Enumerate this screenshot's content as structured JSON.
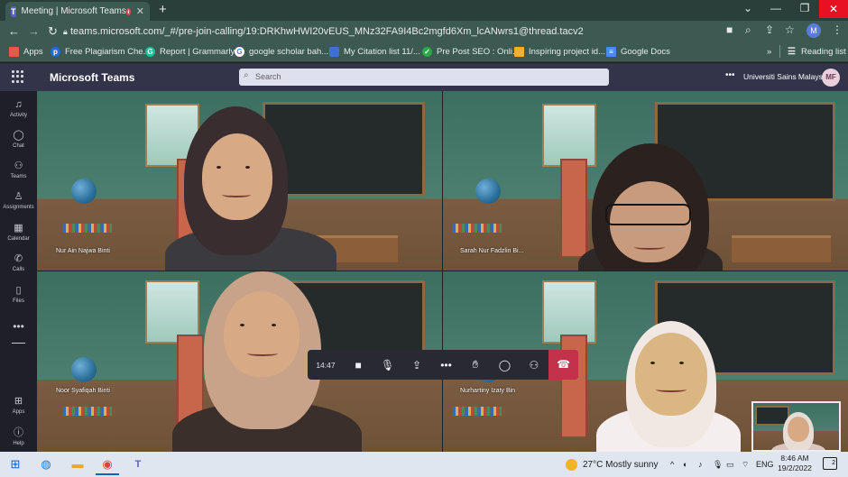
{
  "browser": {
    "tab_title": "Meeting | Microsoft Teams",
    "new_tab": "+",
    "url": "teams.microsoft.com/_#/pre-join-calling/19:DRKhwHWI20vEUS_MNz32FA9I4Bc2mgfd6Xm_lcANwrs1@thread.tacv2",
    "profile_initial": "M",
    "reading_list": "Reading list",
    "bookmarks": [
      {
        "label": "Apps",
        "icon": "apps-grid-icon",
        "color": "#e05a4e"
      },
      {
        "label": "Free Plagiarism Che...",
        "icon": "plagiarism-icon",
        "color": "#1d6fd3"
      },
      {
        "label": "Report | Grammarly",
        "icon": "grammarly-icon",
        "color": "#15c39a"
      },
      {
        "label": "google scholar bah...",
        "icon": "google-icon",
        "color": "#ffffff"
      },
      {
        "label": "My Citation list 11/...",
        "icon": "citation-icon",
        "color": "#3d6fd6"
      },
      {
        "label": "Pre Post SEO : Onli...",
        "icon": "prepostseo-icon",
        "color": "#2aa84a"
      },
      {
        "label": "Inspiring project id...",
        "icon": "project-icon",
        "color": "#f0b030"
      },
      {
        "label": "Google Docs",
        "icon": "google-docs-icon",
        "color": "#4a8af4"
      }
    ]
  },
  "teams": {
    "app_name": "Microsoft Teams",
    "search_placeholder": "Search",
    "organization": "Universiti Sains Malaysia",
    "avatar_initials": "MF",
    "rail": [
      {
        "label": "Activity",
        "icon": "bell-icon"
      },
      {
        "label": "Chat",
        "icon": "chat-icon"
      },
      {
        "label": "Teams",
        "icon": "teams-icon"
      },
      {
        "label": "Assignments",
        "icon": "assignments-icon"
      },
      {
        "label": "Calendar",
        "icon": "calendar-icon"
      },
      {
        "label": "Calls",
        "icon": "phone-icon"
      },
      {
        "label": "Files",
        "icon": "files-icon"
      },
      {
        "label": "Apps",
        "icon": "apps-icon"
      },
      {
        "label": "Help",
        "icon": "help-icon"
      }
    ]
  },
  "call": {
    "participants": [
      {
        "name": "Nur Ain Najwa Binti",
        "hijab": "#3a2d30",
        "outfit": "#3b3a3f"
      },
      {
        "name": "Sarah Nur Fadzlin Bi...",
        "hijab": "#2b2220",
        "outfit": "#2e2827"
      },
      {
        "name": "Noor Syafiqah Binti",
        "hijab": "#c8a38a",
        "outfit": "#3a2f2b"
      },
      {
        "name": "Nurhartiny Izaty Bin",
        "hijab": "#f1e8e4",
        "outfit": "#f4eeee"
      }
    ],
    "timer": "14:47",
    "controls": [
      {
        "name": "camera-button",
        "icon": "camera-icon"
      },
      {
        "name": "mic-button",
        "icon": "microphone-icon"
      },
      {
        "name": "share-button",
        "icon": "share-screen-icon"
      },
      {
        "name": "more-button",
        "icon": "more-icon"
      },
      {
        "name": "raise-hand-button",
        "icon": "raise-hand-icon"
      },
      {
        "name": "chat-button",
        "icon": "chat-icon"
      },
      {
        "name": "participants-button",
        "icon": "participants-icon"
      }
    ],
    "hangup_icon": "hang-up-icon"
  },
  "taskbar": {
    "weather": "27°C  Mostly sunny",
    "lang": "ENG",
    "time": "8:46 AM",
    "date": "19/2/2022",
    "notifications": "2"
  }
}
